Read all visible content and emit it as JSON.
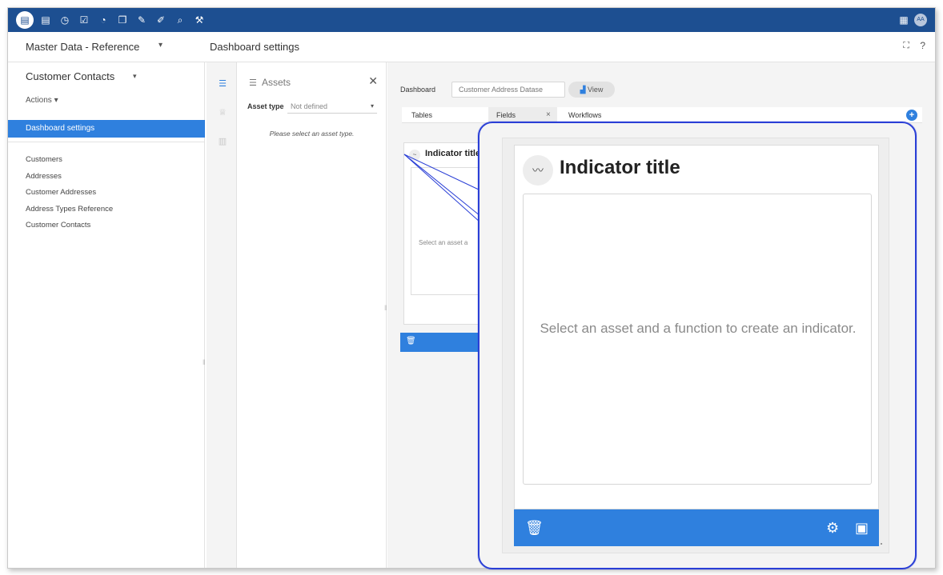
{
  "topbar": {
    "icons": [
      {
        "name": "database-icon",
        "glyph": "▤"
      },
      {
        "name": "clock-icon",
        "glyph": "◷"
      },
      {
        "name": "task-check-icon",
        "glyph": "☑"
      },
      {
        "name": "gauge-icon",
        "glyph": "◔"
      },
      {
        "name": "document-stack-icon",
        "glyph": "❐"
      },
      {
        "name": "edit-check-icon",
        "glyph": "✎"
      },
      {
        "name": "plug-icon",
        "glyph": "✐"
      },
      {
        "name": "search-icon",
        "glyph": "⌕"
      },
      {
        "name": "wrench-icon",
        "glyph": "⚒"
      }
    ],
    "right_icons": [
      {
        "name": "calendar-icon",
        "glyph": "▦"
      }
    ],
    "avatar_text": "AA",
    "color": "#1d4f91"
  },
  "header": {
    "dataspace": "Master Data - Reference",
    "section": "Dashboard settings",
    "expand_glyph": "⛶",
    "help_glyph": "?"
  },
  "sidebar": {
    "title": "Customer Contacts",
    "actions": "Actions ▾",
    "active_item": "Dashboard settings",
    "items": [
      "Customers",
      "Addresses",
      "Customer Addresses",
      "Address Types Reference",
      "Customer Contacts"
    ],
    "accent": "#2f80de"
  },
  "assets": {
    "title": "Assets",
    "type_label": "Asset type",
    "type_value": "Not defined",
    "empty_message": "Please select an asset type."
  },
  "dashboard": {
    "label": "Dashboard",
    "select_value": "Customer Address Datase",
    "view_label": "View",
    "tabs": [
      "Tables",
      "Fields",
      "Workflows"
    ],
    "active_tab": "Fields"
  },
  "indicator": {
    "title": "Indicator title",
    "empty_message": "Select an asset and a function to create an indicator.",
    "empty_message_short": "Select an asset a"
  },
  "callout_color": "#2a3fd6"
}
